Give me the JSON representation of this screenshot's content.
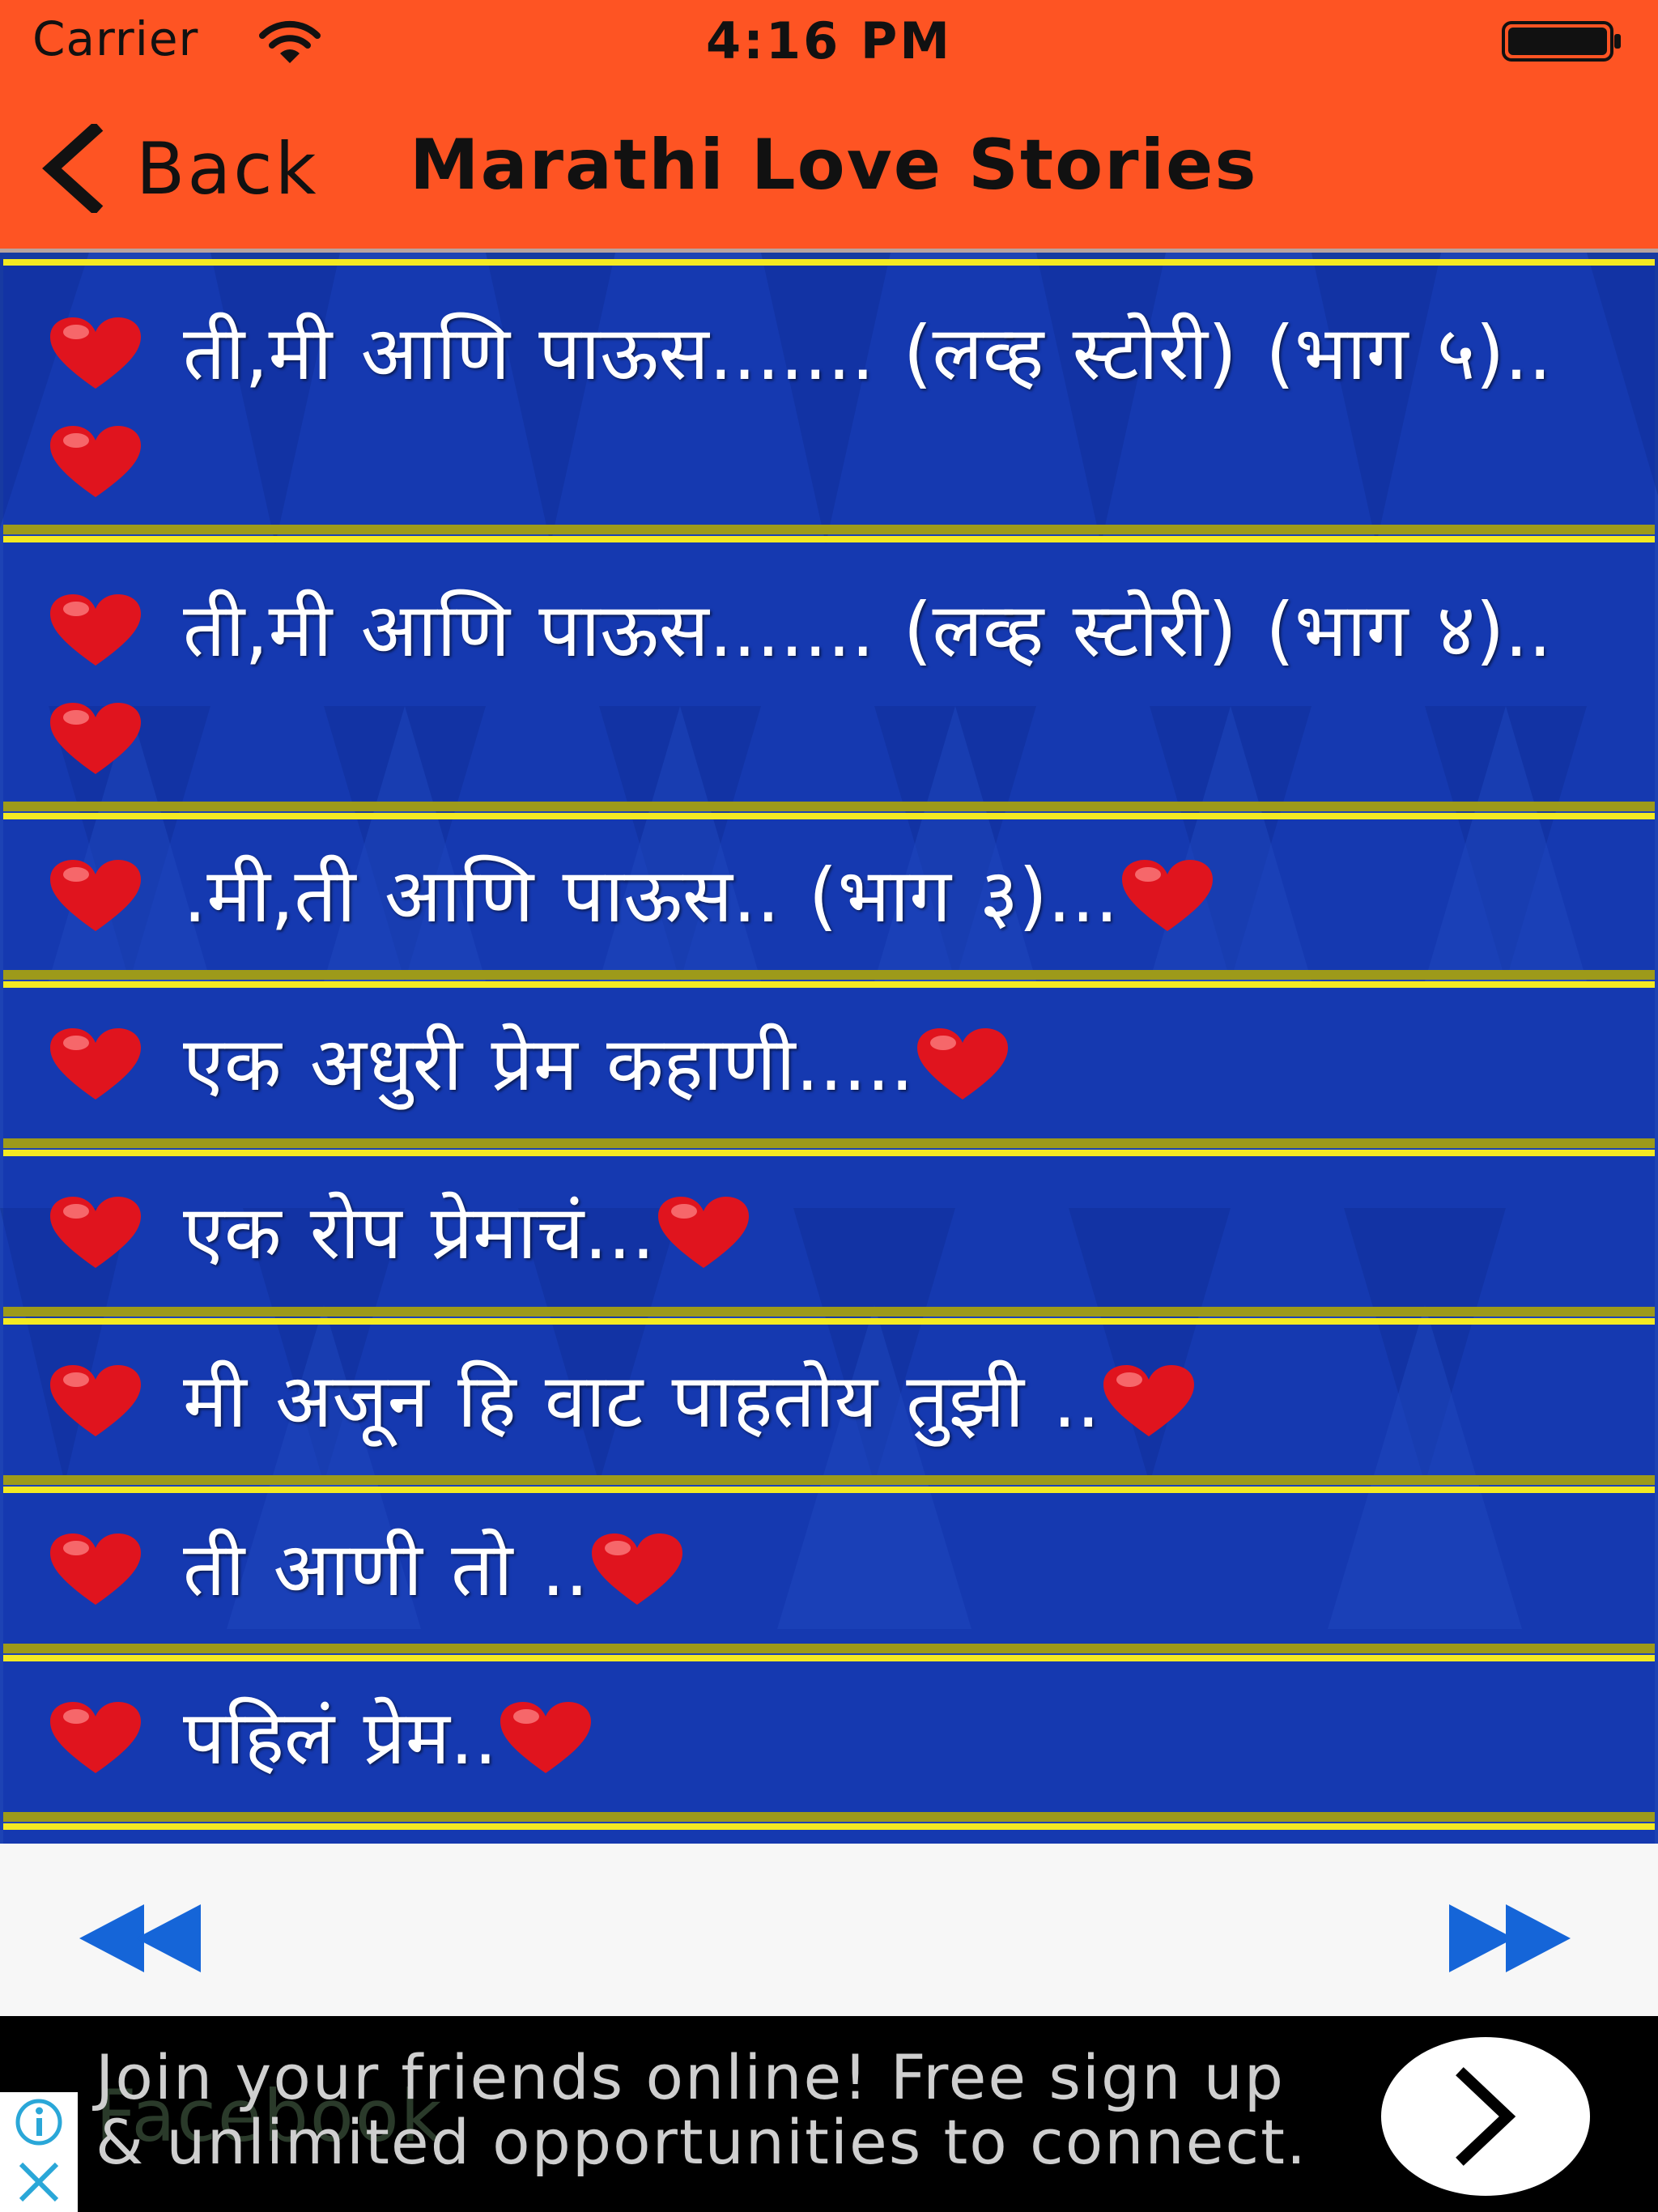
{
  "status_bar": {
    "carrier": "Carrier",
    "time": "4:16 PM"
  },
  "nav": {
    "back_label": "Back",
    "title": "Marathi Love Stories"
  },
  "stories": [
    {
      "label": "ती,मी आणि पाऊस....... (लव्ह स्टोरी) (भाग ५).."
    },
    {
      "label": "ती,मी आणि पाऊस....... (लव्ह स्टोरी) (भाग ४).."
    },
    {
      "label": ".मी,ती आणि पाऊस.. (भाग ३)..."
    },
    {
      "label": "एक अधुरी प्रेम कहाणी....."
    },
    {
      "label": "एक रोप प्रेमाचं..."
    },
    {
      "label": "मी अजून हि वाट पाहतोय तुझी .."
    },
    {
      "label": "ती आणी तो .."
    },
    {
      "label": "पहिलं प्रेम.."
    }
  ],
  "ad": {
    "ghost_text": "Facebook",
    "line1": "Join your friends online! Free sign up",
    "line2": "& unlimited opportunities to connect."
  },
  "colors": {
    "header_bg": "#fe5423",
    "list_bg": "#1b3fae",
    "item_border": "#f4ea22",
    "heart": "#e0141e",
    "pager_arrow": "#1565d8"
  },
  "icons": {
    "back": "chevron-left-icon",
    "previous": "rewind-icon",
    "next": "fast-forward-icon",
    "heart": "heart-icon"
  }
}
